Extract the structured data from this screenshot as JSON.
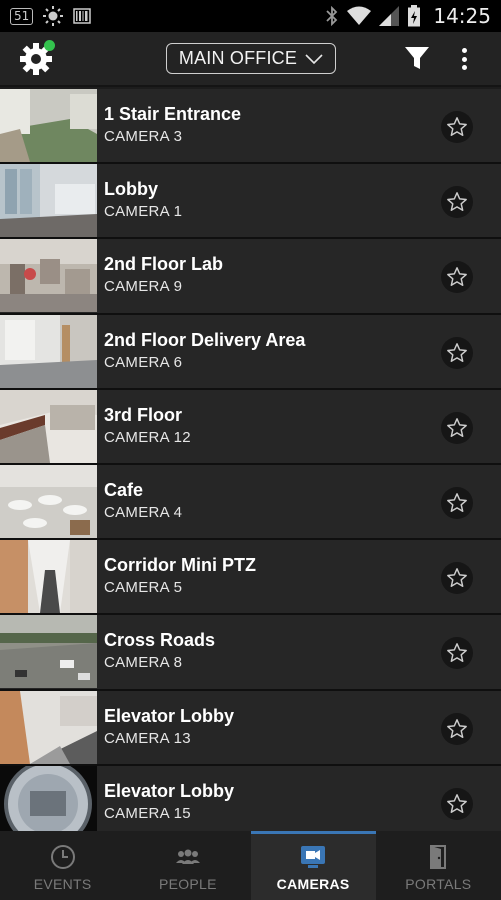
{
  "status_bar": {
    "notification_badge": "51",
    "time": "14:25"
  },
  "app_bar": {
    "location_label": "MAIN OFFICE"
  },
  "cameras": [
    {
      "name": "1 Stair Entrance",
      "camera": "CAMERA 3"
    },
    {
      "name": "Lobby",
      "camera": "CAMERA 1"
    },
    {
      "name": "2nd Floor Lab",
      "camera": "CAMERA 9"
    },
    {
      "name": "2nd Floor Delivery Area",
      "camera": "CAMERA 6"
    },
    {
      "name": "3rd Floor",
      "camera": "CAMERA 12"
    },
    {
      "name": "Cafe",
      "camera": "CAMERA 4"
    },
    {
      "name": "Corridor Mini PTZ",
      "camera": "CAMERA 5"
    },
    {
      "name": "Cross Roads",
      "camera": "CAMERA 8"
    },
    {
      "name": "Elevator Lobby",
      "camera": "CAMERA 13"
    },
    {
      "name": "Elevator Lobby",
      "camera": "CAMERA 15"
    }
  ],
  "bottom_nav": {
    "tabs": [
      {
        "label": "EVENTS",
        "icon": "clock-icon"
      },
      {
        "label": "PEOPLE",
        "icon": "people-icon"
      },
      {
        "label": "CAMERAS",
        "icon": "camera-monitor-icon"
      },
      {
        "label": "PORTALS",
        "icon": "door-icon"
      }
    ],
    "active": "CAMERAS"
  },
  "colors": {
    "accent": "#3a76b5",
    "online_indicator": "#33c24d",
    "background": "#262626"
  }
}
